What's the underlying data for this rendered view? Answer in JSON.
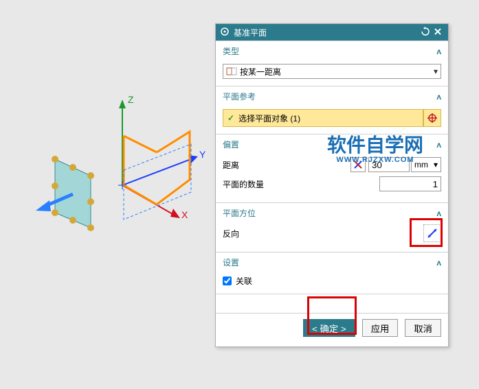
{
  "dialog": {
    "title": "基准平面",
    "sections": {
      "type": {
        "label": "类型",
        "selected": "按某一距离"
      },
      "ref": {
        "label": "平面参考",
        "selection": "选择平面对象 (1)"
      },
      "offset": {
        "label": "偏置",
        "distance_label": "距离",
        "distance_value": "30",
        "distance_unit": "mm",
        "count_label": "平面的数量",
        "count_value": "1"
      },
      "orient": {
        "label": "平面方位",
        "reverse_label": "反向"
      },
      "settings": {
        "label": "设置",
        "assoc_label": "关联",
        "assoc_checked": true
      }
    },
    "buttons": {
      "ok": "< 确定 >",
      "apply": "应用",
      "cancel": "取消"
    }
  },
  "axes": {
    "x": "X",
    "y": "Y",
    "z": "Z"
  },
  "watermark": {
    "main": "软件自学网",
    "sub": "WWW.RJZXW.COM"
  }
}
